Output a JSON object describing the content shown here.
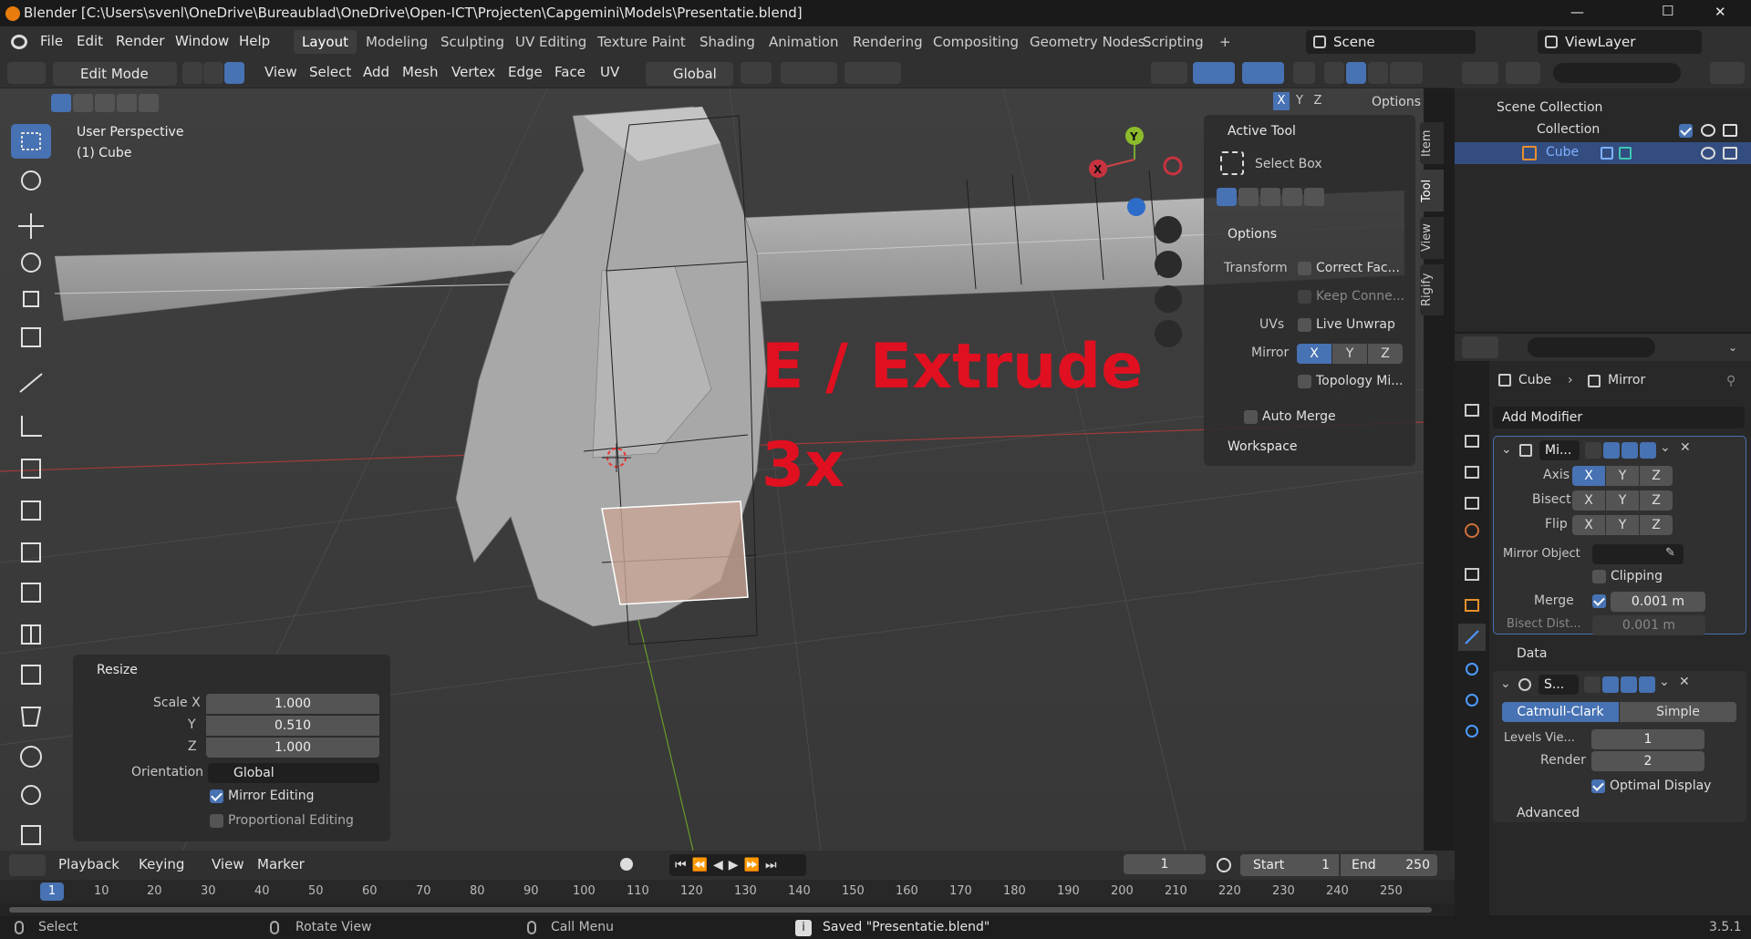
{
  "window": {
    "title": "Blender [C:\\Users\\svenl\\OneDrive\\Bureaublad\\OneDrive\\Open-ICT\\Projecten\\Capgemini\\Models\\Presentatie.blend]",
    "minimize": "—",
    "maximize": "☐",
    "close": "✕"
  },
  "menu": {
    "file": "File",
    "edit": "Edit",
    "render": "Render",
    "window": "Window",
    "help": "Help"
  },
  "workspaces": [
    "Layout",
    "Modeling",
    "Sculpting",
    "UV Editing",
    "Texture Paint",
    "Shading",
    "Animation",
    "Rendering",
    "Compositing",
    "Geometry Nodes",
    "Scripting",
    "+"
  ],
  "scene": {
    "name": "Scene",
    "view_layer": "ViewLayer"
  },
  "header3d": {
    "mode": "Edit Mode",
    "view": "View",
    "select": "Select",
    "add": "Add",
    "mesh": "Mesh",
    "vertex": "Vertex",
    "edge": "Edge",
    "face": "Face",
    "uv": "UV",
    "orientation": "Global",
    "options": "Options",
    "x": "X",
    "y": "Y",
    "z": "Z"
  },
  "viewport": {
    "perspective": "User Perspective",
    "object": "(1) Cube",
    "overlay_line1": "E / Extrude",
    "overlay_line2": "3x",
    "gizmo_x": "X",
    "gizmo_y": "Y"
  },
  "npanel": {
    "tabs": [
      "Item",
      "Tool",
      "View",
      "Rigify"
    ],
    "active_tool": "Active Tool",
    "tool_name": "Select Box",
    "options": "Options",
    "transform": "Transform",
    "correct_face": "Correct Fac...",
    "keep_connected": "Keep Conne...",
    "uvs": "UVs",
    "live_unwrap": "Live Unwrap",
    "mirror": "Mirror",
    "mx": "X",
    "my": "Y",
    "mz": "Z",
    "topology": "Topology Mi...",
    "auto_merge": "Auto Merge",
    "workspace": "Workspace"
  },
  "operator": {
    "title": "Resize",
    "scale_x_label": "Scale X",
    "scale_x": "1.000",
    "y_label": "Y",
    "y": "0.510",
    "z_label": "Z",
    "z": "1.000",
    "orientation_label": "Orientation",
    "orientation": "Global",
    "mirror_editing": "Mirror Editing",
    "proportional": "Proportional Editing"
  },
  "outliner": {
    "scene_collection": "Scene Collection",
    "collection": "Collection",
    "cube": "Cube"
  },
  "properties": {
    "breadcrumb_object": "Cube",
    "breadcrumb_mod": "Mirror",
    "add_modifier": "Add Modifier",
    "mirror": {
      "name": "Mi...",
      "axis": "Axis",
      "bisect": "Bisect",
      "flip": "Flip",
      "x": "X",
      "y": "Y",
      "z": "Z",
      "mirror_object": "Mirror Object",
      "clipping": "Clipping",
      "merge": "Merge",
      "merge_val": "0.001 m",
      "bisect_dist": "Bisect Dist...",
      "bisect_val": "0.001 m",
      "data": "Data"
    },
    "subsurf": {
      "name": "S...",
      "catmull": "Catmull-Clark",
      "simple": "Simple",
      "levels_label": "Levels Vie...",
      "levels": "1",
      "render_label": "Render",
      "render": "2",
      "optimal": "Optimal Display",
      "advanced": "Advanced"
    }
  },
  "timeline": {
    "playback": "Playback",
    "keying": "Keying",
    "view": "View",
    "marker": "Marker",
    "current": "1",
    "start_label": "Start",
    "start": "1",
    "end_label": "End",
    "end": "250",
    "ticks": [
      "1",
      "10",
      "20",
      "30",
      "40",
      "50",
      "60",
      "70",
      "80",
      "90",
      "100",
      "110",
      "120",
      "130",
      "140",
      "150",
      "160",
      "170",
      "180",
      "190",
      "200",
      "210",
      "220",
      "230",
      "240",
      "250"
    ]
  },
  "status": {
    "select": "Select",
    "rotate": "Rotate View",
    "call_menu": "Call Menu",
    "saved": "Saved \"Presentatie.blend\"",
    "version": "3.5.1"
  },
  "colors": {
    "accent": "#4772b3",
    "overlay_text": "#e01020",
    "selected_face": "#c8a595",
    "outliner_highlight": "#334d80"
  }
}
